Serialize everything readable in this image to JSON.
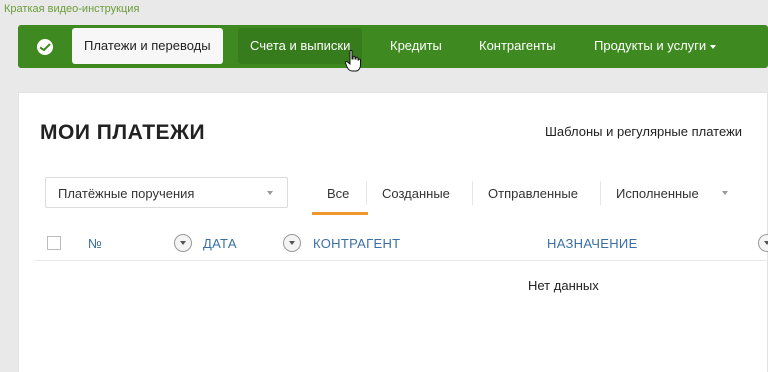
{
  "caption_link": "Краткая видео-инструкция",
  "nav": {
    "items": [
      {
        "label": "Платежи и переводы",
        "state": "active"
      },
      {
        "label": "Счета и выписки",
        "state": "hover"
      },
      {
        "label": "Кредиты",
        "state": "normal"
      },
      {
        "label": "Контрагенты",
        "state": "normal"
      },
      {
        "label": "Продукты и услуги",
        "state": "normal",
        "dropdown": true
      }
    ]
  },
  "page": {
    "title": "МОИ ПЛАТЕЖИ",
    "templates_link": "Шаблоны и регулярные платежи"
  },
  "doc_type_select": {
    "value": "Платёжные поручения"
  },
  "tabs": [
    {
      "label": "Все",
      "active": true
    },
    {
      "label": "Созданные"
    },
    {
      "label": "Отправленные"
    },
    {
      "label": "Исполненные"
    }
  ],
  "table": {
    "columns": [
      "№",
      "ДАТА",
      "КОНТРАГЕНТ",
      "НАЗНАЧЕНИЕ"
    ],
    "empty_text": "Нет данных"
  },
  "colors": {
    "brand_green": "#3f8a20",
    "accent_orange": "#f0962c",
    "link_blue": "#3a6fa6"
  }
}
